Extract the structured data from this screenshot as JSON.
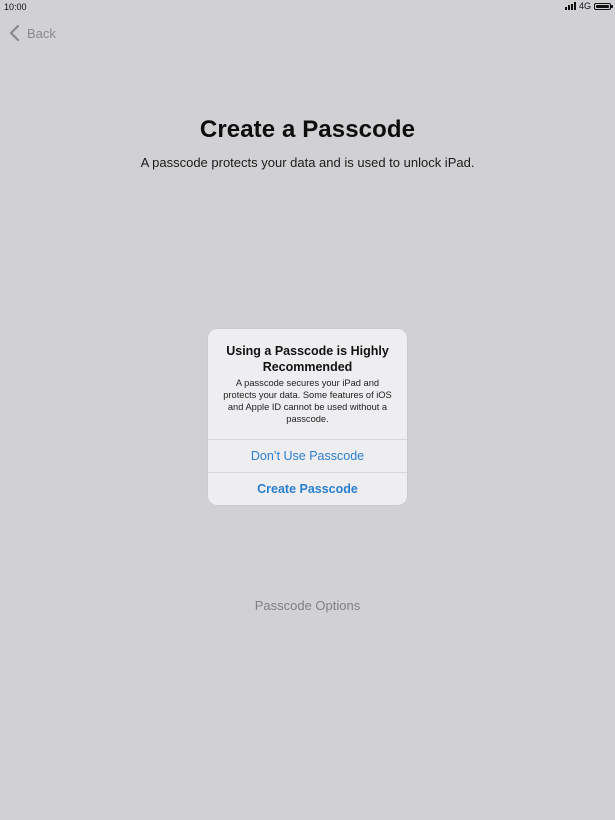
{
  "status_bar": {
    "time": "10:00",
    "network": "4G"
  },
  "nav": {
    "back_label": "Back"
  },
  "page": {
    "title": "Create a Passcode",
    "subtitle": "A passcode protects your data and is used to unlock iPad.",
    "options_link": "Passcode Options"
  },
  "alert": {
    "title": "Using a Passcode is Highly Recommended",
    "message": "A passcode secures your iPad and protects your data. Some features of iOS and Apple ID cannot be used without a passcode.",
    "buttons": {
      "dont_use": "Don’t Use Passcode",
      "create": "Create Passcode"
    }
  },
  "colors": {
    "background": "#d1d0d3",
    "alert_background": "#eeedf0",
    "accent": "#2b7fd0",
    "back_gray": "#8a8a8e"
  },
  "icons": {
    "signal": "signal-bars-icon",
    "battery": "battery-icon",
    "back": "chevron-left-icon"
  }
}
